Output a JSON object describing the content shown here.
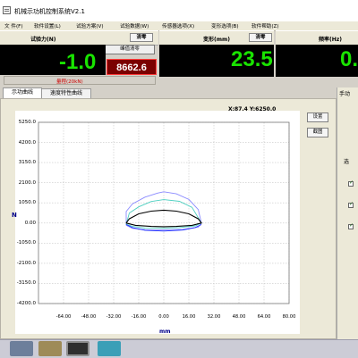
{
  "title": "机械示功机控制系统V2.1",
  "menus": [
    "文 件(F)",
    "软件设置(L)",
    "试验方案(V)",
    "试验数据(W)",
    "传感器选项(X)",
    "变形选项(B)",
    "软件帮助(Z)"
  ],
  "force_panel": {
    "label": "试验力(N)",
    "clear_label": "清零",
    "value": "-1.0",
    "calib_button": "峰值清零",
    "peak_value": "8662.6",
    "range_note": "量程(20kN)"
  },
  "deform_panel": {
    "label": "变形(mm)",
    "clear_label": "清零",
    "value": "23.5"
  },
  "freq_panel": {
    "label": "频率(Hz)",
    "value": "0."
  },
  "tabs": [
    "示功曲线",
    "速度特性曲线"
  ],
  "right_panel_tab": "手动",
  "right_panel_header": "选",
  "plot_actions": [
    "设置",
    "截图"
  ],
  "coord_readout": "X:87.4 Y:6250.0",
  "axis_units": {
    "x": "mm",
    "y": "N"
  },
  "chart_data": {
    "type": "line",
    "xlabel": "mm",
    "ylabel": "N",
    "xlim": [
      -80,
      80
    ],
    "ylim": [
      -4200,
      5250
    ],
    "x_ticks": [
      "-64.00",
      "-48.00",
      "-32.00",
      "-16.00",
      "0.00",
      "16.00",
      "32.00",
      "48.00",
      "64.00",
      "80.00"
    ],
    "y_ticks": [
      "5250.0",
      "4200.0",
      "3150.0",
      "2100.0",
      "1050.0",
      "0.00",
      "-1050.0",
      "-2100.0",
      "-3150.0",
      "-4200.0"
    ],
    "grid": true,
    "series": [
      {
        "color": "#8a8aff",
        "points": [
          [
            -24,
            -120
          ],
          [
            -24,
            600
          ],
          [
            -20,
            1000
          ],
          [
            -12,
            1350
          ],
          [
            -4,
            1560
          ],
          [
            0,
            1630
          ],
          [
            8,
            1520
          ],
          [
            16,
            1230
          ],
          [
            22,
            700
          ],
          [
            24,
            0
          ],
          [
            22,
            -220
          ],
          [
            12,
            -330
          ],
          [
            0,
            -360
          ],
          [
            -12,
            -350
          ],
          [
            -20,
            -280
          ],
          [
            -24,
            -120
          ]
        ]
      },
      {
        "color": "#4ccfc0",
        "points": [
          [
            -24,
            -60
          ],
          [
            -22,
            520
          ],
          [
            -16,
            840
          ],
          [
            -8,
            1120
          ],
          [
            0,
            1220
          ],
          [
            10,
            1130
          ],
          [
            18,
            820
          ],
          [
            24,
            0
          ],
          [
            20,
            -150
          ],
          [
            10,
            -240
          ],
          [
            0,
            -270
          ],
          [
            -12,
            -260
          ],
          [
            -20,
            -180
          ],
          [
            -24,
            -60
          ]
        ]
      },
      {
        "color": "#000000",
        "points": [
          [
            -24,
            0
          ],
          [
            -22,
            220
          ],
          [
            -16,
            480
          ],
          [
            -8,
            620
          ],
          [
            0,
            670
          ],
          [
            8,
            620
          ],
          [
            16,
            480
          ],
          [
            22,
            220
          ],
          [
            24,
            0
          ],
          [
            18,
            -120
          ],
          [
            8,
            -180
          ],
          [
            0,
            -190
          ],
          [
            -8,
            -180
          ],
          [
            -18,
            -120
          ],
          [
            -24,
            0
          ]
        ]
      },
      {
        "color": "#1d2cff",
        "points": [
          [
            -24,
            -80
          ],
          [
            -20,
            -240
          ],
          [
            -12,
            -380
          ],
          [
            0,
            -420
          ],
          [
            12,
            -370
          ],
          [
            20,
            -240
          ],
          [
            24,
            -80
          ]
        ]
      }
    ]
  }
}
